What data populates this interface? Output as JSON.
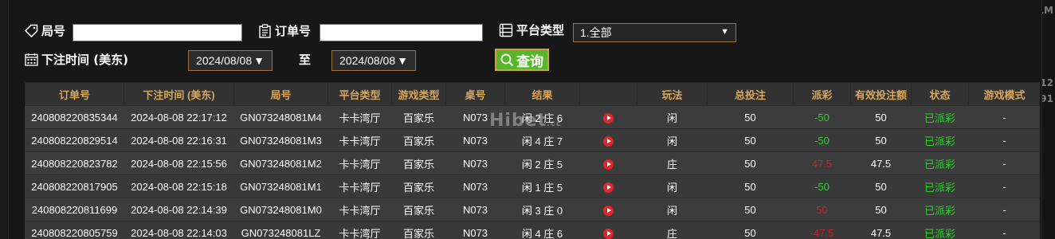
{
  "filters": {
    "ju_label": "局号",
    "ju_value": "",
    "order_label": "订单号",
    "order_value": "",
    "platform_label": "平台类型",
    "platform_value": "1.全部",
    "time_label": "下注时间 (美东)",
    "date_from": "2024/08/08",
    "to_label": "至",
    "date_to": "2024/08/08",
    "query_label": "查询"
  },
  "table": {
    "headers": [
      "订单号",
      "下注时间 (美东)",
      "局号",
      "平台类型",
      "游戏类型",
      "桌号",
      "结果",
      "",
      "玩法",
      "总投注",
      "派彩",
      "有效投注额",
      "状态",
      "游戏模式"
    ],
    "rows": [
      {
        "order": "240808220835344",
        "time": "2024-08-08 22:17:12",
        "round": "GN073248081M4",
        "platform": "卡卡湾厅",
        "game": "百家乐",
        "table": "N073",
        "result": "闲 2 庄 6",
        "play": "闲",
        "bet": "50",
        "payout": "-50",
        "payout_color": "#2fcf2f",
        "valid": "50",
        "status": "已派彩",
        "mode": "-"
      },
      {
        "order": "240808220829514",
        "time": "2024-08-08 22:16:31",
        "round": "GN073248081M3",
        "platform": "卡卡湾厅",
        "game": "百家乐",
        "table": "N073",
        "result": "闲 4 庄 7",
        "play": "闲",
        "bet": "50",
        "payout": "-50",
        "payout_color": "#2fcf2f",
        "valid": "50",
        "status": "已派彩",
        "mode": "-"
      },
      {
        "order": "240808220823782",
        "time": "2024-08-08 22:15:56",
        "round": "GN073248081M2",
        "platform": "卡卡湾厅",
        "game": "百家乐",
        "table": "N073",
        "result": "闲 2 庄 5",
        "play": "庄",
        "bet": "50",
        "payout": "47.5",
        "payout_color": "#c8242b",
        "valid": "47.5",
        "status": "已派彩",
        "mode": "-"
      },
      {
        "order": "240808220817905",
        "time": "2024-08-08 22:15:18",
        "round": "GN073248081M1",
        "platform": "卡卡湾厅",
        "game": "百家乐",
        "table": "N073",
        "result": "闲 1 庄 5",
        "play": "闲",
        "bet": "50",
        "payout": "-50",
        "payout_color": "#2fcf2f",
        "valid": "50",
        "status": "已派彩",
        "mode": "-"
      },
      {
        "order": "240808220811699",
        "time": "2024-08-08 22:14:39",
        "round": "GN073248081M0",
        "platform": "卡卡湾厅",
        "game": "百家乐",
        "table": "N073",
        "result": "闲 3 庄 0",
        "play": "闲",
        "bet": "50",
        "payout": "50",
        "payout_color": "#c8242b",
        "valid": "50",
        "status": "已派彩",
        "mode": "-"
      },
      {
        "order": "240808220805759",
        "time": "2024-08-08 22:14:03",
        "round": "GN073248081LZ",
        "platform": "卡卡湾厅",
        "game": "百家乐",
        "table": "N073",
        "result": "闲 4 庄 6",
        "play": "庄",
        "bet": "50",
        "payout": "-47.5",
        "payout_color": "#c8242b",
        "valid": "47.5",
        "status": "已派彩",
        "mode": "-"
      }
    ]
  },
  "colors": {
    "header_text": "#d9a75b",
    "status_green": "#2fcf2f",
    "query_button": "#58b62a"
  },
  "watermark": {
    "main": "Hibet",
    "suffix": ".cc"
  },
  "background": {
    "right_top": "1M",
    "right_mid1": "12",
    "right_mid2": "91"
  },
  "icons": {
    "ju": "tag-icon",
    "order": "clipboard-icon",
    "platform": "list-icon",
    "time": "calendar-icon",
    "query": "search-icon",
    "row_action": "play-icon"
  }
}
